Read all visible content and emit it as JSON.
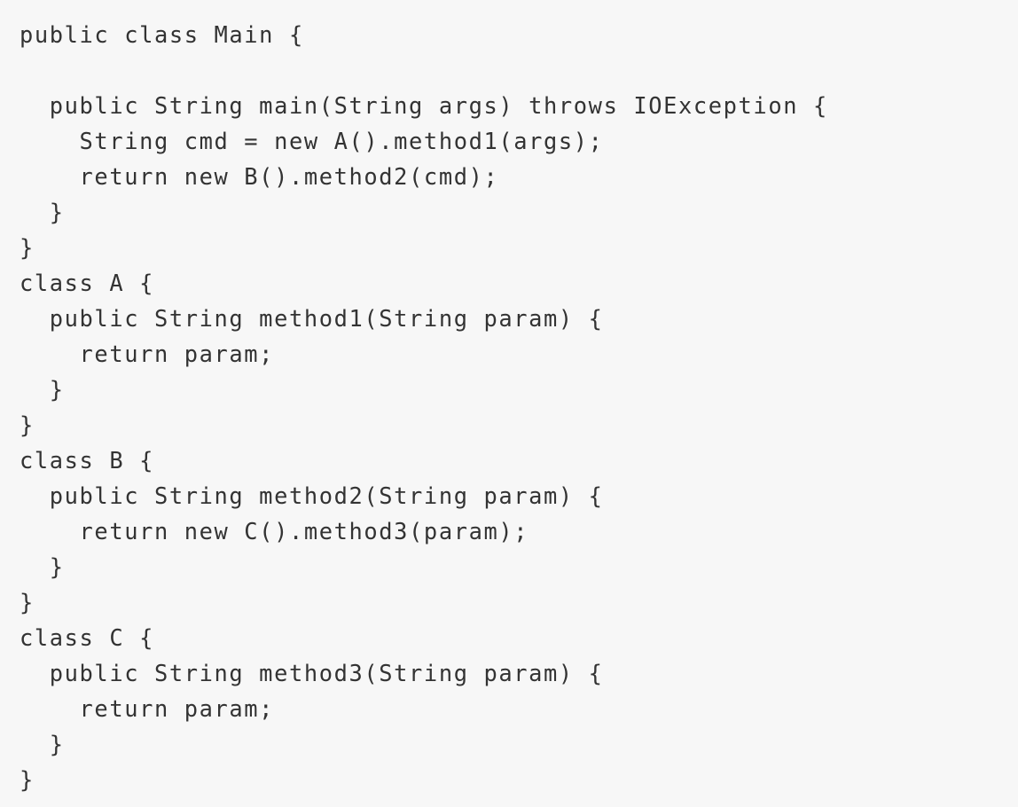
{
  "code": {
    "language": "java",
    "lines": [
      "public class Main {",
      "",
      "  public String main(String args) throws IOException {",
      "    String cmd = new A().method1(args);",
      "    return new B().method2(cmd);",
      "  }",
      "}",
      "class A {",
      "  public String method1(String param) {",
      "    return param;",
      "  }",
      "}",
      "class B {",
      "  public String method2(String param) {",
      "    return new C().method3(param);",
      "  }",
      "}",
      "class C {",
      "  public String method3(String param) {",
      "    return param;",
      "  }",
      "}"
    ]
  }
}
